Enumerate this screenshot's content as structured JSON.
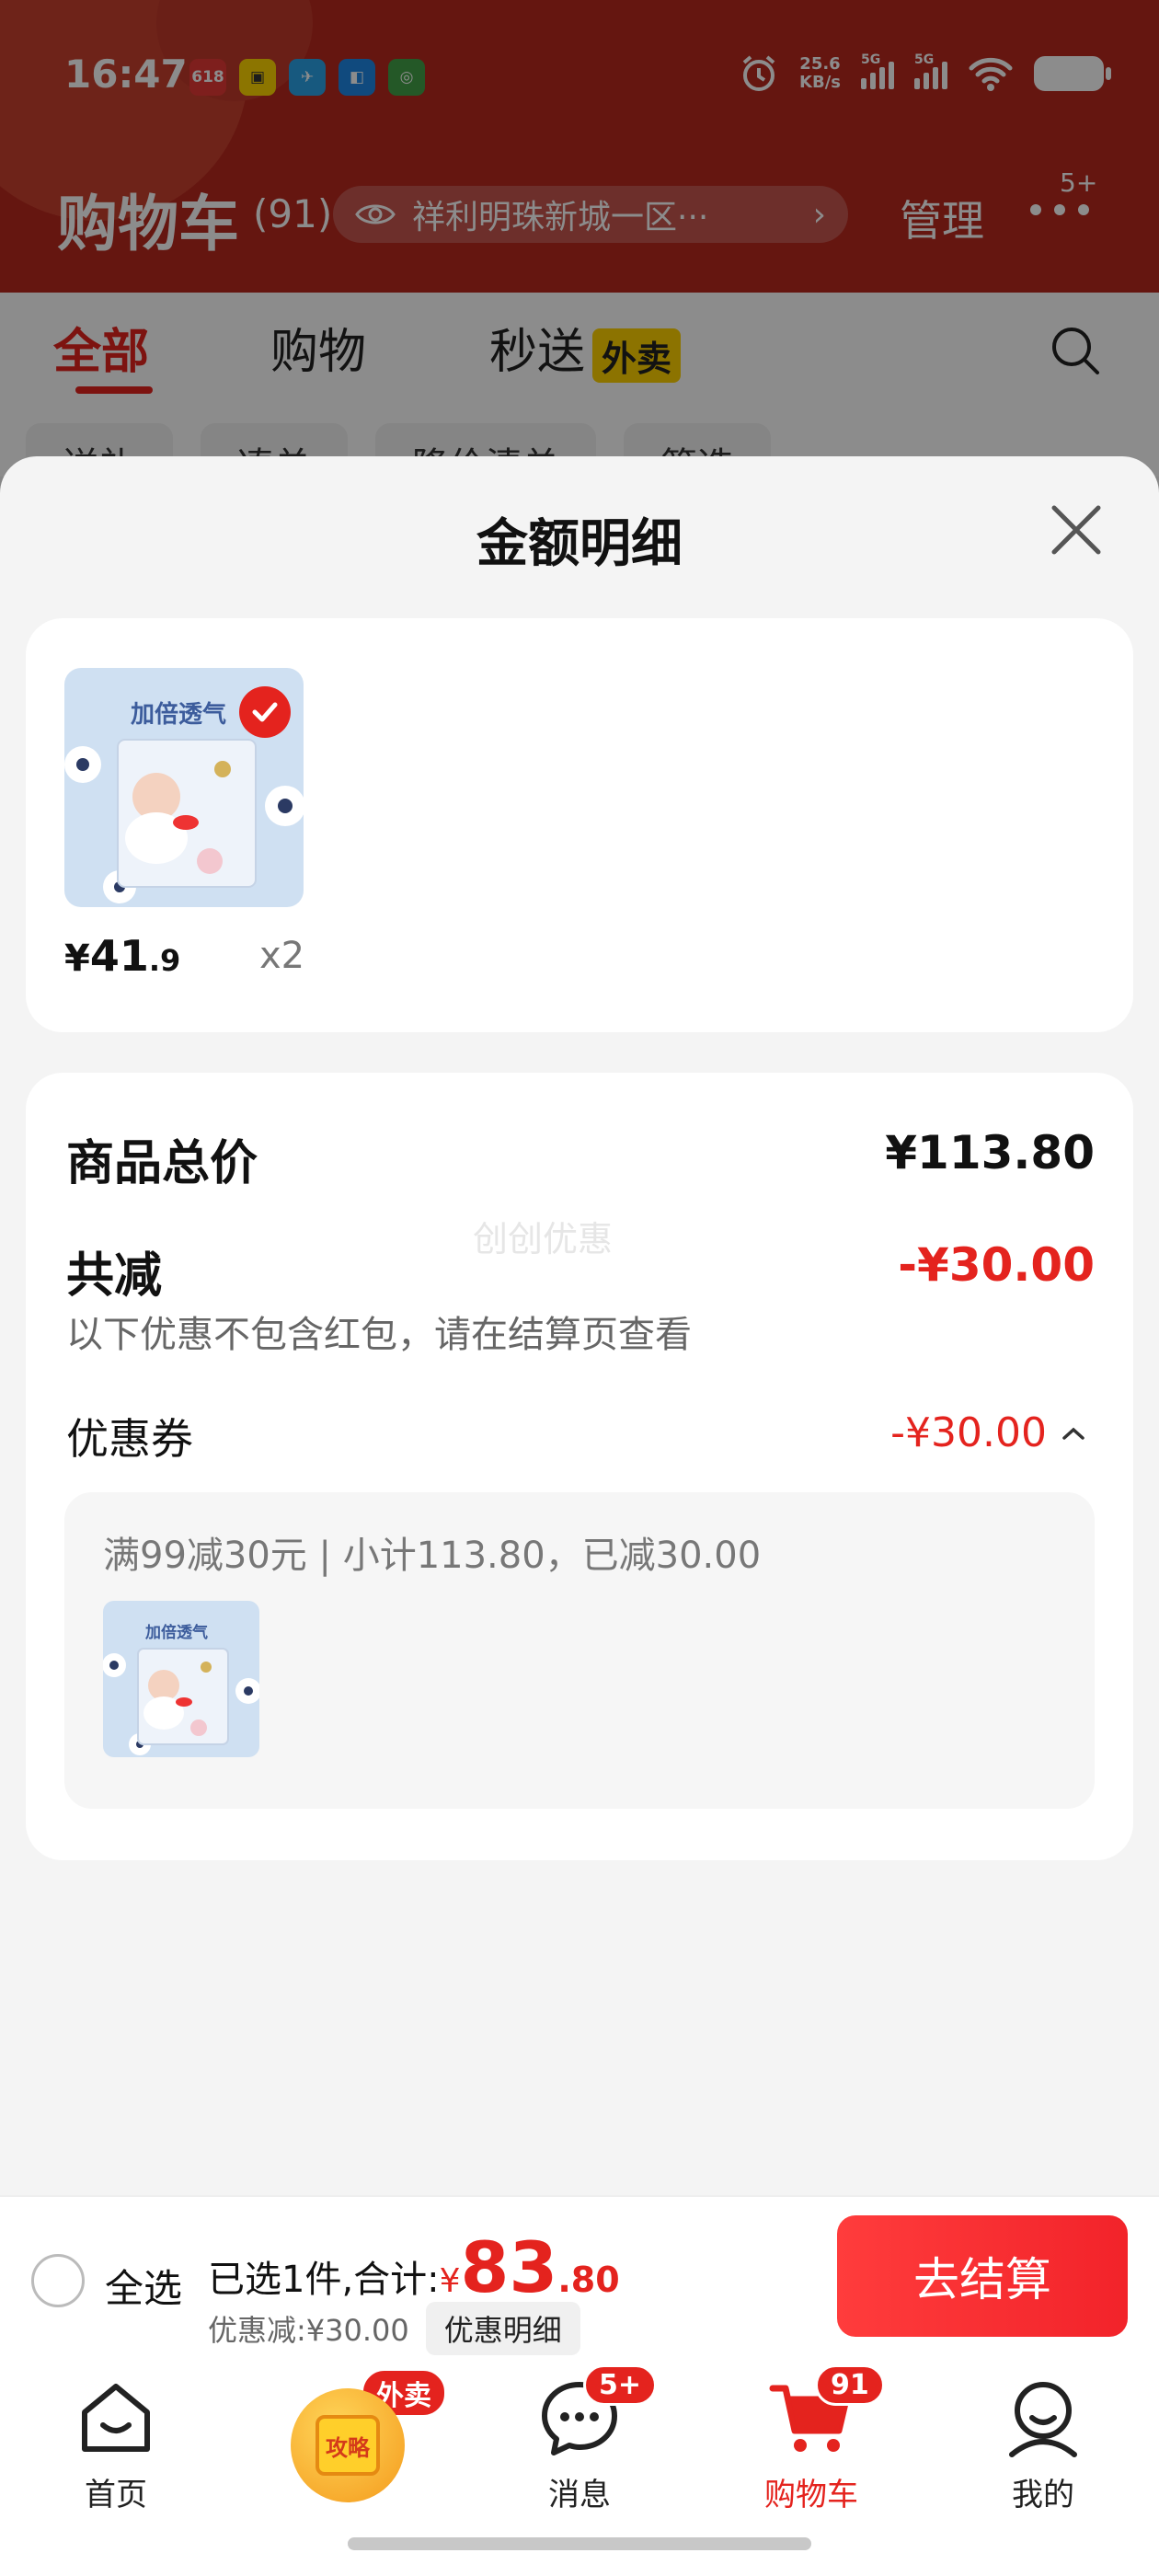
{
  "status_bar": {
    "time": "16:47",
    "net_speed_value": "25.6",
    "net_speed_unit": "KB/s",
    "signal_1": "5G",
    "signal_2": "5G"
  },
  "header": {
    "title": "购物车",
    "count": "(91)",
    "address": "祥利明珠新城一区···",
    "manage_label": "管理",
    "more_badge": "5+"
  },
  "tabs": [
    {
      "label": "全部"
    },
    {
      "label": "购物"
    },
    {
      "label": "秒送",
      "tag": "外卖"
    }
  ],
  "filter_chips": [
    "送礼",
    "凑单",
    "降价清单",
    "筛选"
  ],
  "sheet": {
    "title": "金额明细",
    "product": {
      "thumb_text": "加倍透气",
      "price_yen": "¥",
      "price_int": "41",
      "price_dec": ".9",
      "qty": "x2"
    },
    "summary": {
      "total_label": "商品总价",
      "total_value": "¥113.80",
      "reduce_label": "共减",
      "reduce_value": "-¥30.00",
      "note": "以下优惠不包含红包，请在结算页查看",
      "watermark": "创创优惠",
      "coupon_label": "优惠券",
      "coupon_value": "-¥30.00",
      "coupon_desc": "满99减30元 | 小计113.80，已减30.00",
      "coupon_thumb_text": "加倍透气"
    }
  },
  "checkout": {
    "select_all": "全选",
    "selected_prefix": "已选1件,合计:",
    "total_yen": "¥",
    "total_int": "83",
    "total_dec": ".80",
    "discount_text": "优惠减:¥30.00",
    "detail_label": "优惠明细",
    "button_label": "去结算"
  },
  "nav": {
    "home": "首页",
    "guide_badge": "外卖",
    "guide_text": "攻略",
    "messages": "消息",
    "messages_badge": "5+",
    "cart": "购物车",
    "cart_badge": "91",
    "mine": "我的"
  },
  "colors": {
    "accent": "#e4231e",
    "header_bg": "#b8281e",
    "tag_yellow": "#ffd200"
  }
}
